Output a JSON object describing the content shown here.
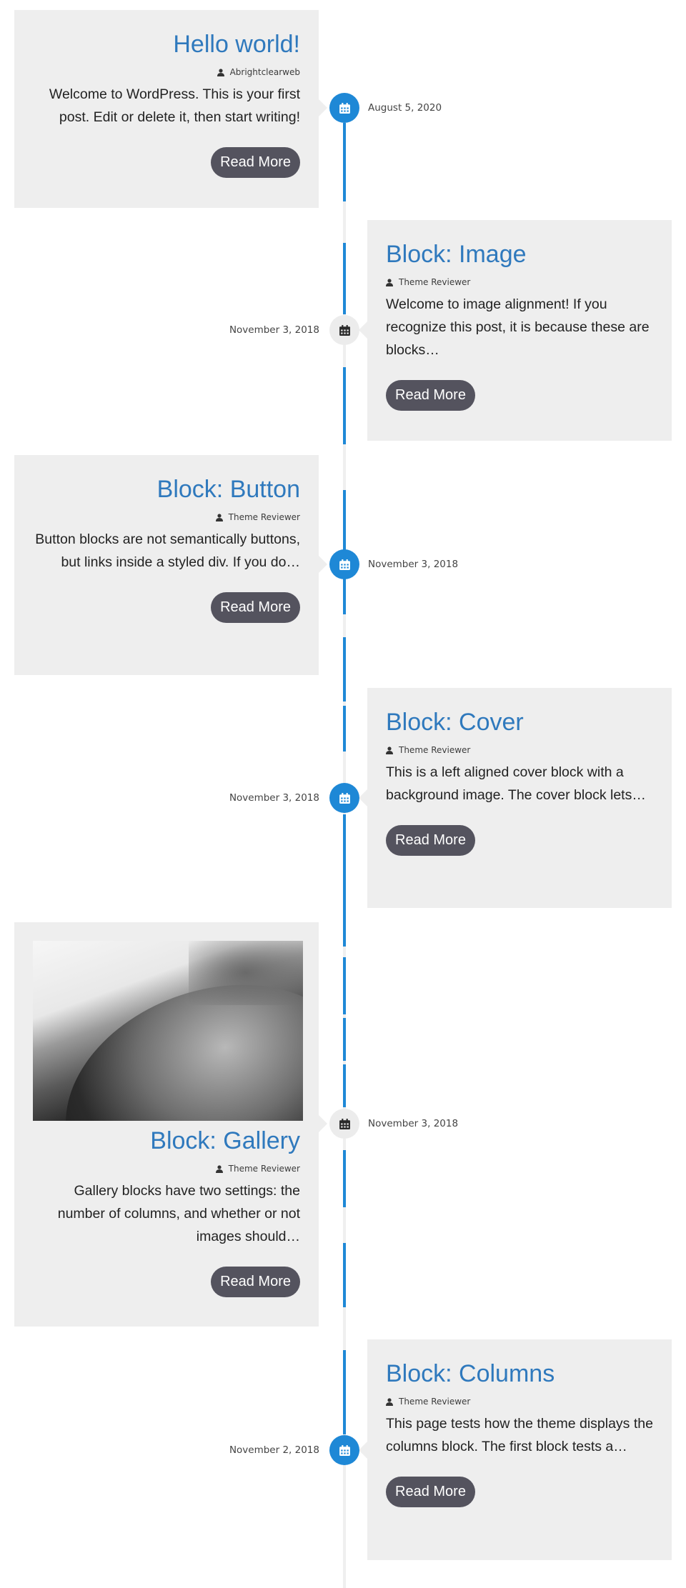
{
  "timeline": {
    "accent_color": "#1e88d6",
    "posts": [
      {
        "title": "Hello world!",
        "author": "Abrightclearweb",
        "excerpt": "Welcome to WordPress. This is your first post. Edit or delete it, then start writing!",
        "button": "Read More",
        "date": "August 5, 2020",
        "side": "left",
        "icon_style": "blue",
        "has_image": false
      },
      {
        "title": "Block: Image",
        "author": "Theme Reviewer",
        "excerpt": "Welcome to image alignment! If you recognize this post, it is because these are blocks…",
        "button": "Read More",
        "date": "November 3, 2018",
        "side": "right",
        "icon_style": "grey",
        "has_image": false
      },
      {
        "title": "Block: Button",
        "author": "Theme Reviewer",
        "excerpt": "Button blocks are not semantically buttons, but links inside a styled div.  If you do…",
        "button": "Read More",
        "date": "November 3, 2018",
        "side": "left",
        "icon_style": "blue",
        "has_image": false
      },
      {
        "title": "Block: Cover",
        "author": "Theme Reviewer",
        "excerpt": "This is a left aligned cover block with a background image. The cover block lets…",
        "button": "Read More",
        "date": "November 3, 2018",
        "side": "right",
        "icon_style": "blue",
        "has_image": false
      },
      {
        "title": "Block: Gallery",
        "author": "Theme Reviewer",
        "excerpt": "Gallery blocks have two settings: the number of columns, and whether or not images should…",
        "button": "Read More",
        "date": "November 3, 2018",
        "side": "left",
        "icon_style": "grey",
        "has_image": true,
        "image_alt": "Black and white close-up of a weathered curved surface"
      },
      {
        "title": "Block: Columns",
        "author": "Theme Reviewer",
        "excerpt": "This page tests how the theme displays the columns block. The first block tests a…",
        "button": "Read More",
        "date": "November 2, 2018",
        "side": "right",
        "icon_style": "blue",
        "has_image": false
      }
    ]
  },
  "icons": {
    "author": "user-icon",
    "date": "calendar-icon"
  }
}
